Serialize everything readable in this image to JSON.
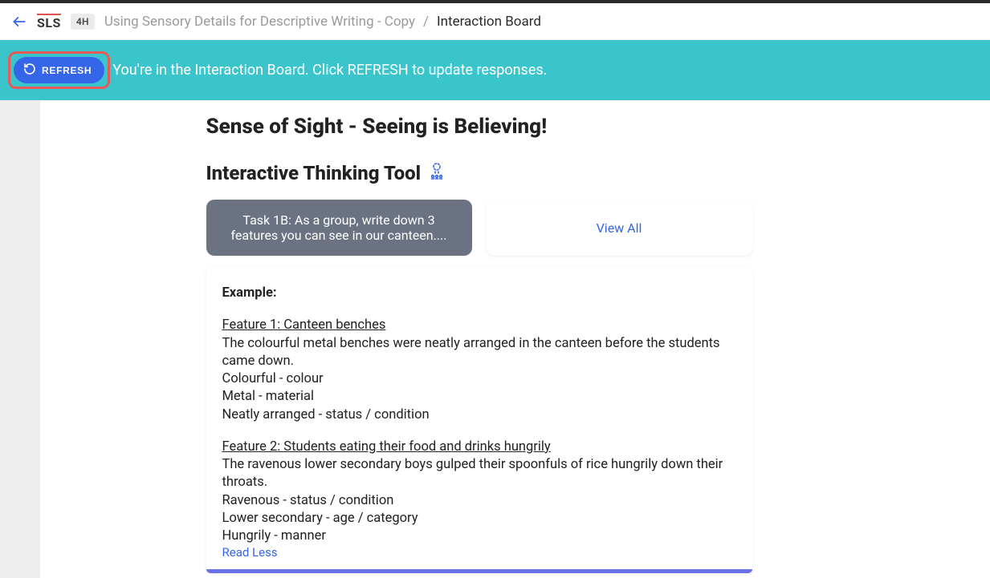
{
  "header": {
    "logo": "SLS",
    "badge": "4H",
    "breadcrumb_item": "Using Sensory Details for Descriptive Writing - Copy",
    "breadcrumb_sep": "/",
    "breadcrumb_current": "Interaction Board"
  },
  "banner": {
    "refresh_label": "REFRESH",
    "text": "You're in the Interaction Board. Click REFRESH to update responses."
  },
  "page": {
    "title": "Sense of Sight - Seeing is Believing!",
    "tool_title": "Interactive Thinking Tool"
  },
  "tabs": {
    "task": "Task 1B: As a group, write down 3 features you can see in our canteen....",
    "viewall": "View All"
  },
  "card": {
    "example_label": "Example:",
    "feature1_title": "Feature 1: Canteen benches",
    "feature1_desc": "The colourful metal benches were neatly arranged in the canteen before the students came down.",
    "feature1_line1": "Colourful - colour",
    "feature1_line2": "Metal - material",
    "feature1_line3": "Neatly arranged - status / condition",
    "feature2_title": "Feature 2: Students eating their food and drinks hungrily",
    "feature2_desc": "The ravenous lower secondary boys gulped their spoonfuls of rice hungrily down their throats.",
    "feature2_line1": "Ravenous - status / condition",
    "feature2_line2": "Lower secondary - age / category",
    "feature2_line3": "Hungrily - manner",
    "read_less": "Read Less"
  }
}
